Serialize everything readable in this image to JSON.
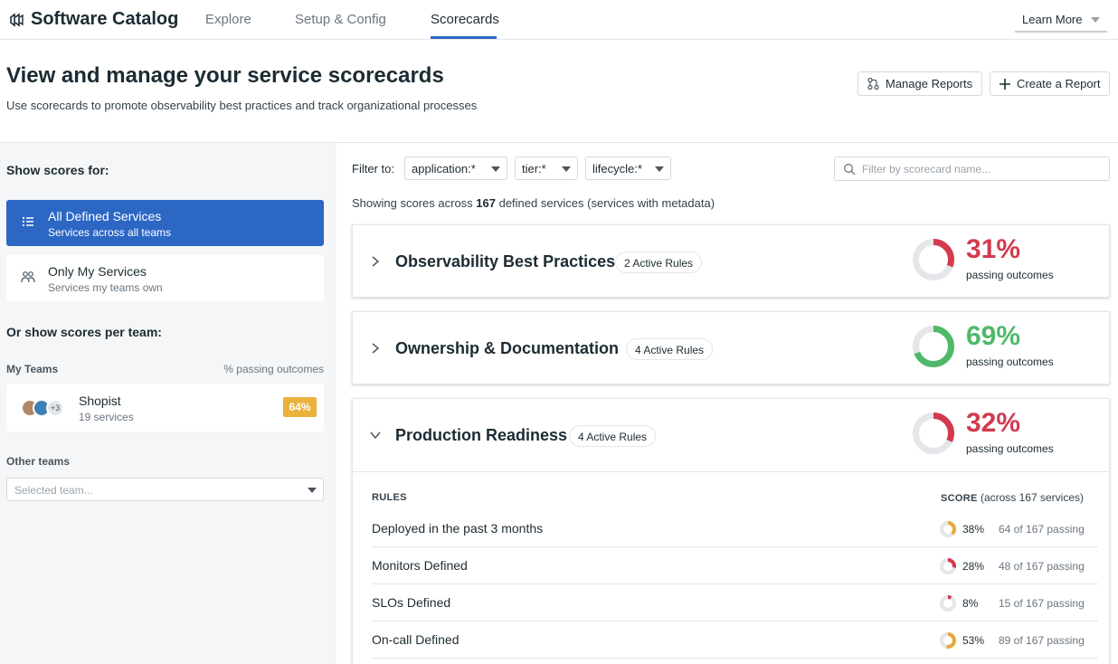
{
  "app": {
    "title": "Software Catalog",
    "tabs": [
      {
        "label": "Explore",
        "active": false
      },
      {
        "label": "Setup & Config",
        "active": false
      },
      {
        "label": "Scorecards",
        "active": true
      }
    ],
    "learn_more": "Learn More"
  },
  "header": {
    "title": "View and manage your service scorecards",
    "subtitle": "Use scorecards to promote observability best practices and track organizational processes",
    "manage_reports": "Manage Reports",
    "create_report": "Create a Report"
  },
  "sidebar": {
    "show_scores_for": "Show scores for:",
    "items": [
      {
        "title": "All Defined Services",
        "desc": "Services across all teams",
        "active": true,
        "icon": "list-icon"
      },
      {
        "title": "Only My Services",
        "desc": "Services my teams own",
        "active": false,
        "icon": "team-icon"
      }
    ],
    "per_team_heading": "Or show scores per team:",
    "my_teams_label": "My Teams",
    "pct_label": "% passing outcomes",
    "team": {
      "name": "Shopist",
      "count": "19 services",
      "extra_members": "+3",
      "badge": "64%"
    },
    "other_teams_label": "Other teams",
    "team_select_placeholder": "Selected team..."
  },
  "filters": {
    "label": "Filter to:",
    "application": "application:*",
    "tier": "tier:*",
    "lifecycle": "lifecycle:*",
    "search_placeholder": "Filter by scorecard name..."
  },
  "showing": {
    "prefix": "Showing scores across ",
    "count": "167",
    "suffix": " defined services (services with metadata)"
  },
  "scorecards": [
    {
      "title": "Observability Best Practices",
      "rules": "2 Active Rules",
      "pct": "31%",
      "pct_value": 0.31,
      "status": "fail",
      "caption": "passing outcomes",
      "expanded": false
    },
    {
      "title": "Ownership & Documentation",
      "rules": "4 Active Rules",
      "pct": "69%",
      "pct_value": 0.69,
      "status": "pass",
      "caption": "passing outcomes",
      "expanded": false
    },
    {
      "title": "Production Readiness",
      "rules": "4 Active Rules",
      "pct": "32%",
      "pct_value": 0.32,
      "status": "fail",
      "caption": "passing outcomes",
      "expanded": true
    }
  ],
  "rules_table": {
    "rules_header": "RULES",
    "score_header": "SCORE",
    "score_header_suffix": " (across 167 services)",
    "rows": [
      {
        "name": "Deployed in the past 3 months",
        "pct": "38%",
        "pct_value": 0.38,
        "passing": "64 of 167 passing",
        "status": "warn"
      },
      {
        "name": "Monitors Defined",
        "pct": "28%",
        "pct_value": 0.28,
        "passing": "48 of 167 passing",
        "status": "fail"
      },
      {
        "name": "SLOs Defined",
        "pct": "8%",
        "pct_value": 0.08,
        "passing": "15 of 167 passing",
        "status": "fail"
      },
      {
        "name": "On-call Defined",
        "pct": "53%",
        "pct_value": 0.53,
        "passing": "89 of 167 passing",
        "status": "warn"
      }
    ]
  },
  "colors": {
    "accent": "#2c67c4",
    "pass": "#4fb86a",
    "fail": "#d33a4f",
    "warn": "#e9a93a",
    "track": "#e4e6e9"
  }
}
